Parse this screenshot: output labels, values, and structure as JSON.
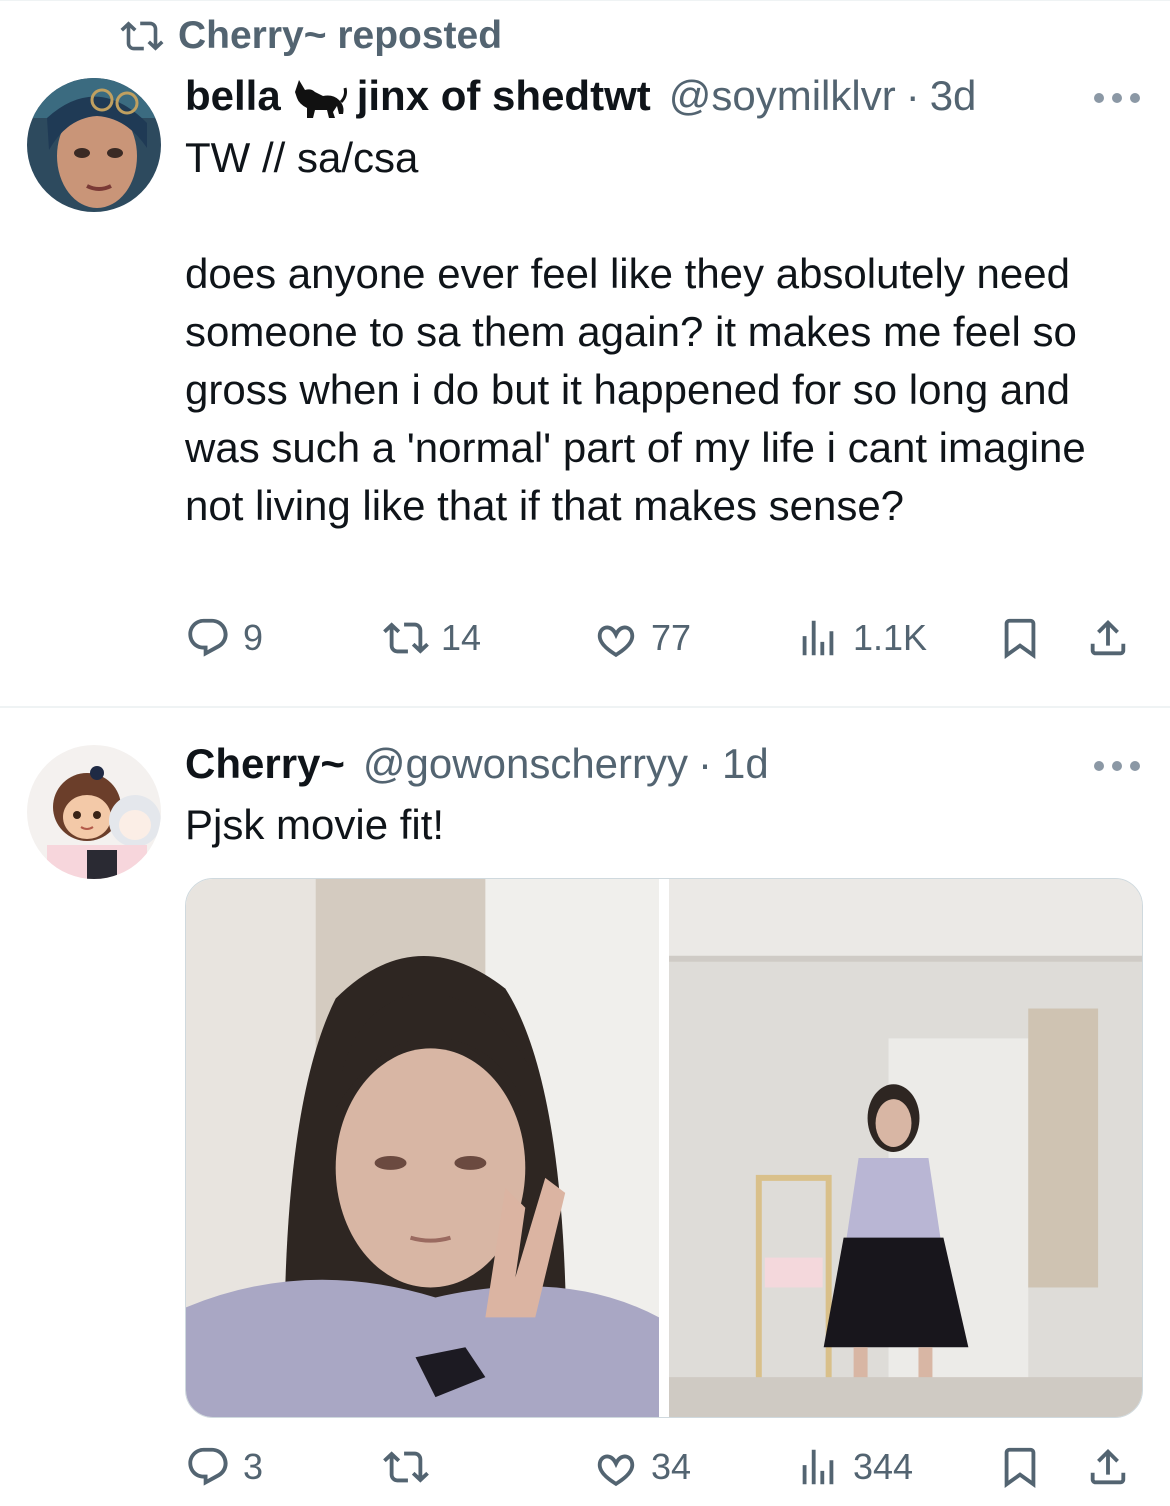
{
  "repost": {
    "label": "Cherry~ reposted",
    "icon": "repost-icon"
  },
  "tweets": [
    {
      "display_name": "bella",
      "name_emoji": "cat-icon",
      "name_suffix": "jinx of shedtwt",
      "handle": "@soymilklvr",
      "time": "3d",
      "text": "TW // sa/csa\n\ndoes anyone ever feel like they absolutely need someone to sa them again? it makes me feel so gross when i do but it happened for so long and was such a 'normal' part of my life i cant imagine not living like that if that makes sense?",
      "stats": {
        "replies": "9",
        "reposts": "14",
        "likes": "77",
        "views": "1.1K"
      }
    },
    {
      "display_name": "Cherry~",
      "handle": "@gowonscherryy",
      "time": "1d",
      "text": "Pjsk movie fit!",
      "stats": {
        "replies": "3",
        "reposts": "",
        "likes": "34",
        "views": "344"
      }
    }
  ],
  "colors": {
    "text": "#0f1419",
    "secondary": "#536471",
    "divider": "#eff3f4"
  }
}
